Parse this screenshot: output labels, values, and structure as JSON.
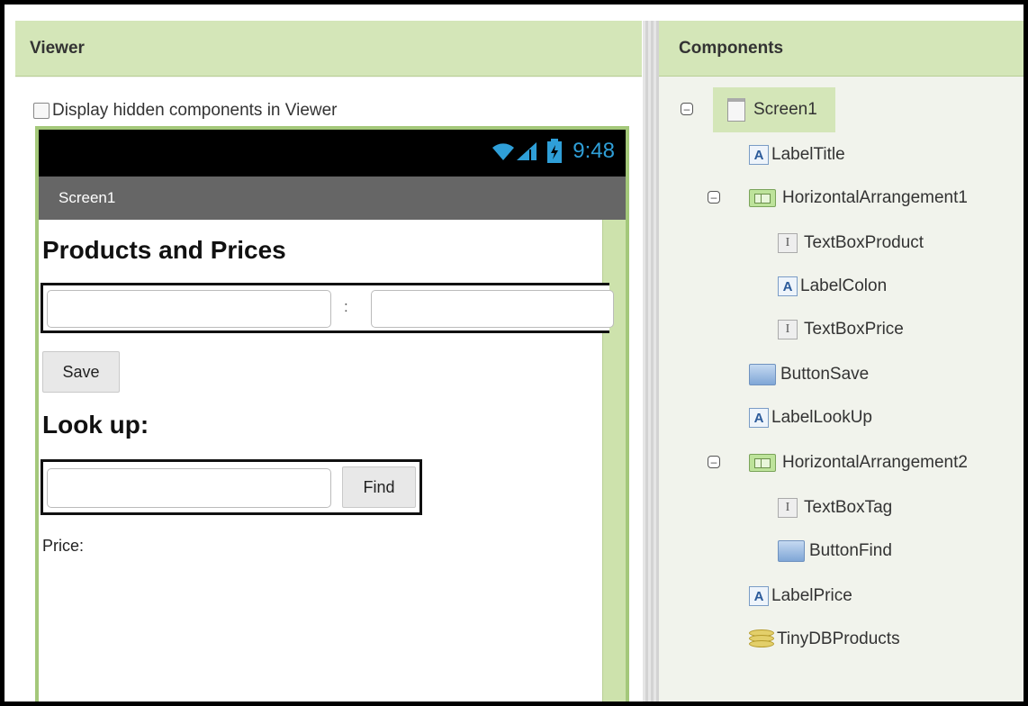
{
  "viewer": {
    "title": "Viewer",
    "hidden_option_label": "Display hidden components in Viewer"
  },
  "phone": {
    "time": "9:48",
    "screen_title": "Screen1",
    "heading_products": "Products and Prices",
    "colon": ":",
    "save_button": "Save",
    "heading_lookup": "Look up:",
    "find_button": "Find",
    "price_label": "Price:"
  },
  "components": {
    "title": "Components",
    "items": [
      {
        "label": "Screen1",
        "icon": "screen-icon",
        "level": 0,
        "expandable": true
      },
      {
        "label": "LabelTitle",
        "icon": "label-icon",
        "level": 1,
        "expandable": false
      },
      {
        "label": "HorizontalArrangement1",
        "icon": "horizontal-arrangement-icon",
        "level": 1,
        "expandable": true
      },
      {
        "label": "TextBoxProduct",
        "icon": "textbox-icon",
        "level": 2,
        "expandable": false
      },
      {
        "label": "LabelColon",
        "icon": "label-icon",
        "level": 2,
        "expandable": false
      },
      {
        "label": "TextBoxPrice",
        "icon": "textbox-icon",
        "level": 2,
        "expandable": false
      },
      {
        "label": "ButtonSave",
        "icon": "button-icon",
        "level": 1,
        "expandable": false
      },
      {
        "label": "LabelLookUp",
        "icon": "label-icon",
        "level": 1,
        "expandable": false
      },
      {
        "label": "HorizontalArrangement2",
        "icon": "horizontal-arrangement-icon",
        "level": 1,
        "expandable": true
      },
      {
        "label": "TextBoxTag",
        "icon": "textbox-icon",
        "level": 2,
        "expandable": false
      },
      {
        "label": "ButtonFind",
        "icon": "button-icon",
        "level": 2,
        "expandable": false
      },
      {
        "label": "LabelPrice",
        "icon": "label-icon",
        "level": 1,
        "expandable": false
      },
      {
        "label": "TinyDBProducts",
        "icon": "database-icon",
        "level": 1,
        "expandable": false
      }
    ]
  },
  "colors": {
    "panel_header": "#d4e6b8",
    "phone_border": "#a4c87a",
    "status_icon": "#2f9fd8",
    "titlebar": "#666666"
  }
}
